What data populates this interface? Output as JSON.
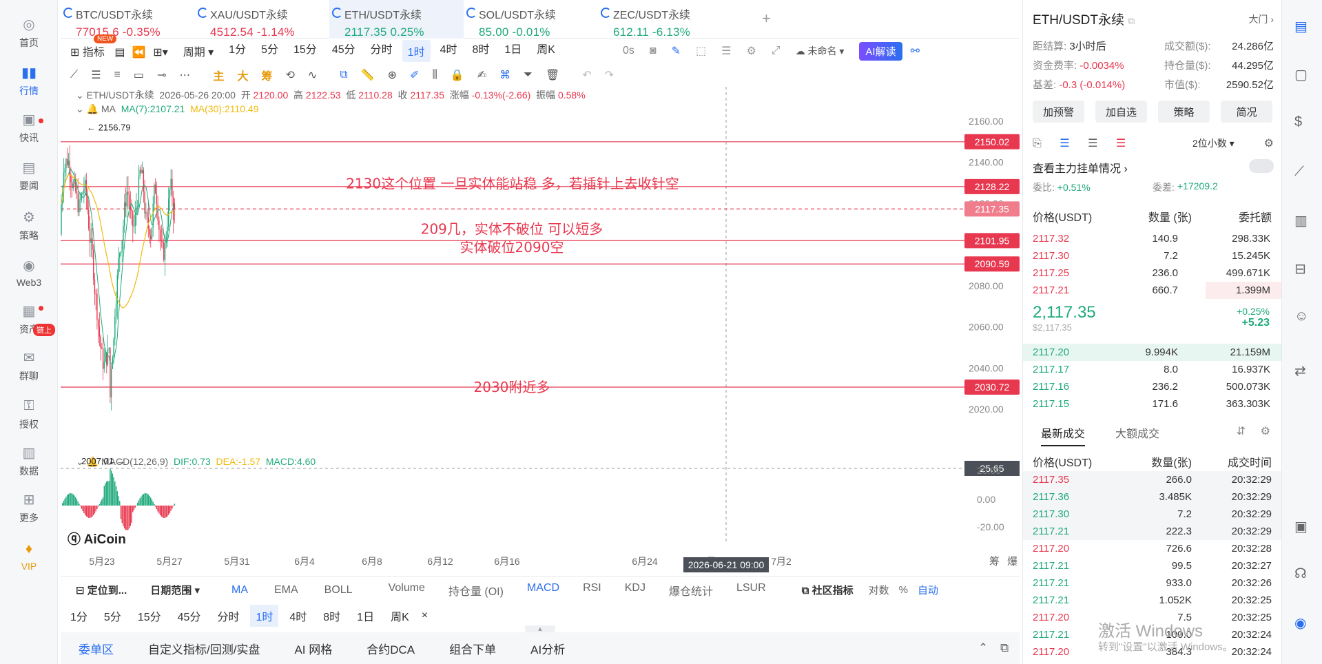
{
  "nav": [
    {
      "label": "首页",
      "icon": "home-icon"
    },
    {
      "label": "行情",
      "icon": "market-chart-icon"
    },
    {
      "label": "快讯",
      "icon": "news-flash-icon"
    },
    {
      "label": "要闻",
      "icon": "headline-icon"
    },
    {
      "label": "策略",
      "icon": "robot-icon"
    },
    {
      "label": "Web3",
      "icon": "web3-icon"
    },
    {
      "label": "资产",
      "icon": "wallet-icon"
    },
    {
      "label": "群聊",
      "icon": "chat-icon"
    },
    {
      "label": "授权",
      "icon": "key-icon"
    },
    {
      "label": "数据",
      "icon": "data-icon"
    },
    {
      "label": "更多",
      "icon": "more-grid-icon"
    },
    {
      "label": "VIP",
      "icon": "vip-icon"
    }
  ],
  "nav_badge": "链上",
  "new_badge": "NEW",
  "tabs": [
    {
      "name": "BTC/USDT永续",
      "price": "77015.6",
      "change": "-0.35%",
      "dir": "down"
    },
    {
      "name": "XAU/USDT永续",
      "price": "4512.54",
      "change": "-1.14%",
      "dir": "down"
    },
    {
      "name": "ETH/USDT永续",
      "price": "2117.35",
      "change": "0.25%",
      "dir": "up"
    },
    {
      "name": "SOL/USDT永续",
      "price": "85.00",
      "change": "-0.01%",
      "dir": "up"
    },
    {
      "name": "ZEC/USDT永续",
      "price": "612.11",
      "change": "-6.13%",
      "dir": "up"
    }
  ],
  "toolbar": {
    "indicator": "指标",
    "period": "周期",
    "periods": [
      "1分",
      "5分",
      "15分",
      "45分",
      "分时",
      "1时",
      "4时",
      "8时",
      "1日",
      "周K"
    ],
    "active_period": "1时",
    "timer": "0s",
    "unnamed": "未命名",
    "ai": "AI解读"
  },
  "draw_tools": {
    "main": "主",
    "big": "大",
    "chip": "筹"
  },
  "ohlc": {
    "symbol": "ETH/USDT永续",
    "time": "2026-05-26 20:00",
    "open_label": "开",
    "open": "2120.00",
    "high_label": "高",
    "high": "2122.53",
    "low_label": "低",
    "low": "2110.28",
    "close_label": "收",
    "close": "2117.35",
    "chg_label": "涨幅",
    "chg": "-0.13%(-2.66)",
    "amp_label": "振幅",
    "amp": "0.58%"
  },
  "ma": {
    "label": "MA",
    "ma7": "MA(7):2107.21",
    "ma30": "MA(30):2110.49"
  },
  "macd": {
    "label": "MACD(12,26,9)",
    "dif": "DIF:0.73",
    "dea": "DEA:-1.57",
    "macd": "MACD:4.60",
    "value": "25.65",
    "ticks": [
      "20.00",
      "0.00",
      "-20.00"
    ]
  },
  "chart_data": {
    "type": "candlestick",
    "y_ticks": [
      "2160.00",
      "2140.00",
      "2120.00",
      "2100.00",
      "2080.00",
      "2060.00",
      "2040.00",
      "2020.00"
    ],
    "x_ticks": [
      "5月23",
      "5月27",
      "5月31",
      "6月4",
      "6月8",
      "6月12",
      "6月16",
      "6月24",
      "6月28",
      "7月2"
    ],
    "crosshair_date": "2026-06-21 09:00",
    "high_mark": "← 2156.79",
    "low_mark": "2007.01 →",
    "levels": [
      {
        "price": 2150.02,
        "label": "2150.02"
      },
      {
        "price": 2128.22,
        "label": "2128.22"
      },
      {
        "price": 2117.35,
        "label": "2117.35",
        "current": true
      },
      {
        "price": 2101.95,
        "label": "2101.95"
      },
      {
        "price": 2090.59,
        "label": "2090.59"
      },
      {
        "price": 2030.72,
        "label": "2030.72"
      }
    ],
    "annotations": [
      "2130这个位置  一旦实体能站稳  多，若插针上去收针空",
      "209几，实体不破位  可以短多",
      "实体破位2090空",
      "2030附近多"
    ],
    "price_range": [
      2000,
      2170
    ],
    "corner_labels": [
      "筹",
      "爆"
    ]
  },
  "logo": "AiCoin",
  "indicator_bar": {
    "locate": "定位到...",
    "range": "日期范围",
    "main": [
      "MA",
      "EMA",
      "BOLL"
    ],
    "sub": [
      "Volume",
      "持仓量 (OI)",
      "MACD",
      "RSI",
      "KDJ",
      "爆仓统计",
      "LSUR"
    ],
    "community": "社区指标",
    "log": "对数",
    "pct": "%",
    "auto": "自动"
  },
  "period_bar": [
    "1分",
    "5分",
    "15分",
    "45分",
    "分时",
    "1时",
    "4时",
    "8时",
    "1日",
    "周K"
  ],
  "period_close": "×",
  "bottom_tabs": [
    "委单区",
    "自定义指标/回测/实盘",
    "AI 网格",
    "合约DCA",
    "组合下单",
    "AI分析"
  ],
  "right": {
    "title": "ETH/USDT永续",
    "exchange": "大门",
    "settle_label": "距结算:",
    "settle": "3小时后",
    "turnover_label": "成交额($):",
    "turnover": "24.286亿",
    "rate_label": "资金费率:",
    "rate": "-0.0034%",
    "oi_label": "持仓量($):",
    "oi": "44.295亿",
    "basis_label": "基差:",
    "basis": "-0.3 (-0.014%)",
    "mcap_label": "市值($):",
    "mcap": "2590.52亿",
    "buttons": [
      "加预警",
      "加自选",
      "策略",
      "简况"
    ],
    "decimals": "2位小数",
    "depth_title": "查看主力挂单情况",
    "ratio_label": "委比:",
    "ratio": "+0.51%",
    "diff_label": "委差:",
    "diff": "+17209.2",
    "ob_headers": [
      "价格(USDT)",
      "数量 (张)",
      "委托额"
    ],
    "asks": [
      [
        "2117.32",
        "140.9",
        "298.33K"
      ],
      [
        "2117.30",
        "7.2",
        "15.245K"
      ],
      [
        "2117.25",
        "236.0",
        "499.671K"
      ],
      [
        "2117.21",
        "660.7",
        "1.399M"
      ]
    ],
    "last": "2,117.35",
    "last_usd": "$2,117.35",
    "last_pct": "+0.25%",
    "last_abs": "+5.23",
    "bids": [
      [
        "2117.20",
        "9.994K",
        "21.159M"
      ],
      [
        "2117.17",
        "8.0",
        "16.937K"
      ],
      [
        "2117.16",
        "236.2",
        "500.073K"
      ],
      [
        "2117.15",
        "171.6",
        "363.303K"
      ]
    ],
    "trade_tabs": [
      "最新成交",
      "大额成交"
    ],
    "tr_headers": [
      "价格(USDT)",
      "数量(张)",
      "成交时间"
    ],
    "trades": [
      [
        "2117.35",
        "266.0",
        "20:32:29",
        "down"
      ],
      [
        "2117.36",
        "3.485K",
        "20:32:29",
        "up"
      ],
      [
        "2117.30",
        "7.2",
        "20:32:29",
        "up"
      ],
      [
        "2117.21",
        "222.3",
        "20:32:29",
        "up"
      ],
      [
        "2117.20",
        "726.6",
        "20:32:28",
        "down"
      ],
      [
        "2117.21",
        "99.5",
        "20:32:27",
        "up"
      ],
      [
        "2117.21",
        "933.0",
        "20:32:26",
        "up"
      ],
      [
        "2117.21",
        "1.052K",
        "20:32:25",
        "up"
      ],
      [
        "2117.20",
        "7.5",
        "20:32:25",
        "down"
      ],
      [
        "2117.21",
        "100.0",
        "20:32:24",
        "up"
      ],
      [
        "2117.20",
        "384.3",
        "20:32:24",
        "down"
      ]
    ]
  },
  "watermark": "激活 Windows",
  "watermark_sub": "转到\"设置\"以激活 Windows。",
  "colors": {
    "up": "#1ea97c",
    "down": "#e8384f",
    "accent": "#2a6ff0",
    "ma7": "#1ea97c",
    "ma30": "#f0b90b",
    "level": "#e8384f"
  }
}
